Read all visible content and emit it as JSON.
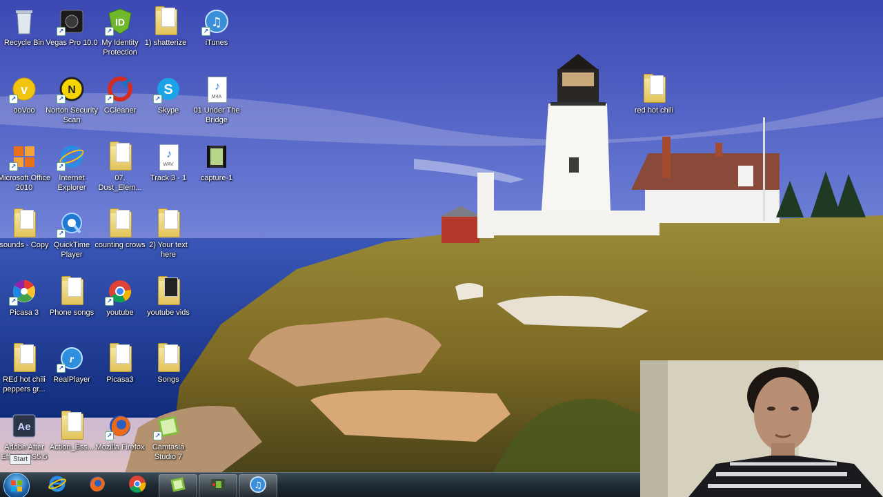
{
  "desktop": {
    "icons": [
      {
        "id": "recycle-bin",
        "label": "Recycle Bin",
        "kind": "recycle-bin-icon"
      },
      {
        "id": "vegas-pro",
        "label": "Vegas Pro 10.0",
        "kind": "vegas-pro-icon"
      },
      {
        "id": "my-identity-protection",
        "label": "My Identity Protection",
        "kind": "identity-shield-icon"
      },
      {
        "id": "shatterize",
        "label": "1) shatterize",
        "kind": "folder-icon"
      },
      {
        "id": "itunes",
        "label": "iTunes",
        "kind": "itunes-icon"
      },
      {
        "id": "oovoo",
        "label": "ooVoo",
        "kind": "oovoo-icon"
      },
      {
        "id": "norton",
        "label": "Norton Security Scan",
        "kind": "norton-icon"
      },
      {
        "id": "ccleaner",
        "label": "CCleaner",
        "kind": "ccleaner-icon"
      },
      {
        "id": "skype",
        "label": "Skype",
        "kind": "skype-icon"
      },
      {
        "id": "under-the-bridge",
        "label": "01 Under The Bridge",
        "kind": "m4a-file-icon"
      },
      {
        "id": "ms-office",
        "label": "Microsoft Office 2010",
        "kind": "office-icon"
      },
      {
        "id": "internet-explorer",
        "label": "Internet Explorer",
        "kind": "internet-explorer-icon"
      },
      {
        "id": "dust-elem",
        "label": "07. Dust_Elem...",
        "kind": "folder-icon"
      },
      {
        "id": "track3",
        "label": "Track 3 - 1",
        "kind": "wav-file-icon"
      },
      {
        "id": "capture1",
        "label": "capture-1",
        "kind": "video-file-icon"
      },
      {
        "id": "sounds-copy",
        "label": "sounds - Copy",
        "kind": "folder-icon"
      },
      {
        "id": "quicktime",
        "label": "QuickTime Player",
        "kind": "quicktime-icon"
      },
      {
        "id": "counting-crows",
        "label": "counting crows",
        "kind": "folder-icon"
      },
      {
        "id": "your-text-here",
        "label": "2) Your text here",
        "kind": "folder-icon"
      },
      {
        "id": "picasa3-app",
        "label": "Picasa 3",
        "kind": "picasa-icon"
      },
      {
        "id": "phone-songs",
        "label": "Phone songs",
        "kind": "folder-icon"
      },
      {
        "id": "youtube",
        "label": "youtube",
        "kind": "chrome-icon"
      },
      {
        "id": "youtube-vids",
        "label": "youtube vids",
        "kind": "folder-icon"
      },
      {
        "id": "red-hot-chili-peppers",
        "label": "REd hot chili peppers gr...",
        "kind": "folder-icon"
      },
      {
        "id": "realplayer",
        "label": "RealPlayer",
        "kind": "realplayer-icon"
      },
      {
        "id": "picasa3-folder",
        "label": "Picasa3",
        "kind": "folder-icon"
      },
      {
        "id": "songs",
        "label": "Songs",
        "kind": "folder-icon"
      },
      {
        "id": "after-effects",
        "label": "Adobe After Effects CS5.5",
        "kind": "after-effects-icon"
      },
      {
        "id": "action-ess",
        "label": "Action_Ess...",
        "kind": "folder-icon"
      },
      {
        "id": "firefox",
        "label": "Mozilla Firefox",
        "kind": "firefox-icon"
      },
      {
        "id": "camtasia",
        "label": "Camtasia Studio 7",
        "kind": "camtasia-icon"
      },
      {
        "id": "red-hot-chili",
        "label": "red hot chili",
        "kind": "folder-icon"
      }
    ]
  },
  "taskbar": {
    "start_tooltip": "Start",
    "buttons": [
      {
        "id": "start",
        "icon": "windows-start-orb-icon"
      },
      {
        "id": "ie",
        "icon": "internet-explorer-icon"
      },
      {
        "id": "firefox",
        "icon": "firefox-icon"
      },
      {
        "id": "chrome",
        "icon": "chrome-icon"
      },
      {
        "id": "camtasia",
        "icon": "camtasia-icon"
      },
      {
        "id": "camtasia-recorder",
        "icon": "camtasia-recorder-icon"
      },
      {
        "id": "itunes",
        "icon": "itunes-icon"
      }
    ]
  },
  "colors": {
    "taskbar": "#1e2a33",
    "desktop_text": "#ffffff",
    "sky_top": "#3d4bb8",
    "sea": "#1d3fa0"
  }
}
